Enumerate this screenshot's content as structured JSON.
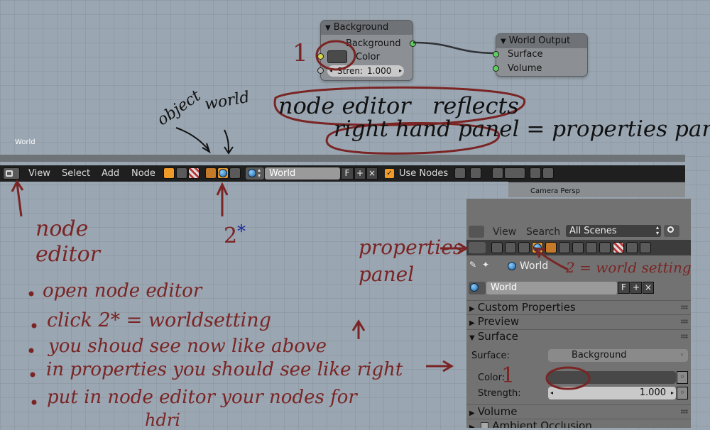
{
  "nodes": {
    "background": {
      "title": "Background",
      "output_label": "Background",
      "color_label": "Color",
      "strength_label": "Stren:",
      "strength_value": "1.000"
    },
    "world_output": {
      "title": "World Output",
      "surface_label": "Surface",
      "volume_label": "Volume"
    }
  },
  "viewport_label": "World",
  "header": {
    "menus": [
      "View",
      "Select",
      "Add",
      "Node"
    ],
    "world_field": "World",
    "fake_user": "F",
    "add": "+",
    "remove": "×",
    "use_nodes_label": "Use Nodes",
    "camera_label": "Camera Persp"
  },
  "properties": {
    "menus": [
      "View",
      "Search"
    ],
    "scene_select": "All Scenes",
    "breadcrumb": "World",
    "world_field": "World",
    "fake_user": "F",
    "add": "+",
    "remove": "×",
    "sections": {
      "custom_properties": "Custom Properties",
      "preview": "Preview",
      "surface": "Surface",
      "volume": "Volume",
      "ambient_occlusion": "Ambient Occlusion"
    },
    "surface_label": "Surface:",
    "surface_value": "Background",
    "color_label": "Color:",
    "strength_label": "Strength:",
    "strength_value": "1.000"
  },
  "annotations": {
    "one_top": "1",
    "object": "object",
    "world": "world",
    "node_editor_reflects": "node editor   reflects",
    "right_hand_panel": "right hand panel = properties panel",
    "node_editor": "node\neditor",
    "two_star": "2",
    "star": "*",
    "properties_panel": "properties\npanel",
    "world_setting": "2 = world setting",
    "one_right": "1",
    "steps": [
      "open node editor",
      "click 2* = worldsetting",
      "you shoud see now like above",
      "in properties you should see like right",
      "put in node editor your nodes for"
    ],
    "hdri": "hdri"
  },
  "colors": {
    "accent_orange": "#f09a2a",
    "socket_green": "#5fcf5f",
    "socket_yellow": "#d7d84a",
    "annotation_red": "#7a2424"
  }
}
